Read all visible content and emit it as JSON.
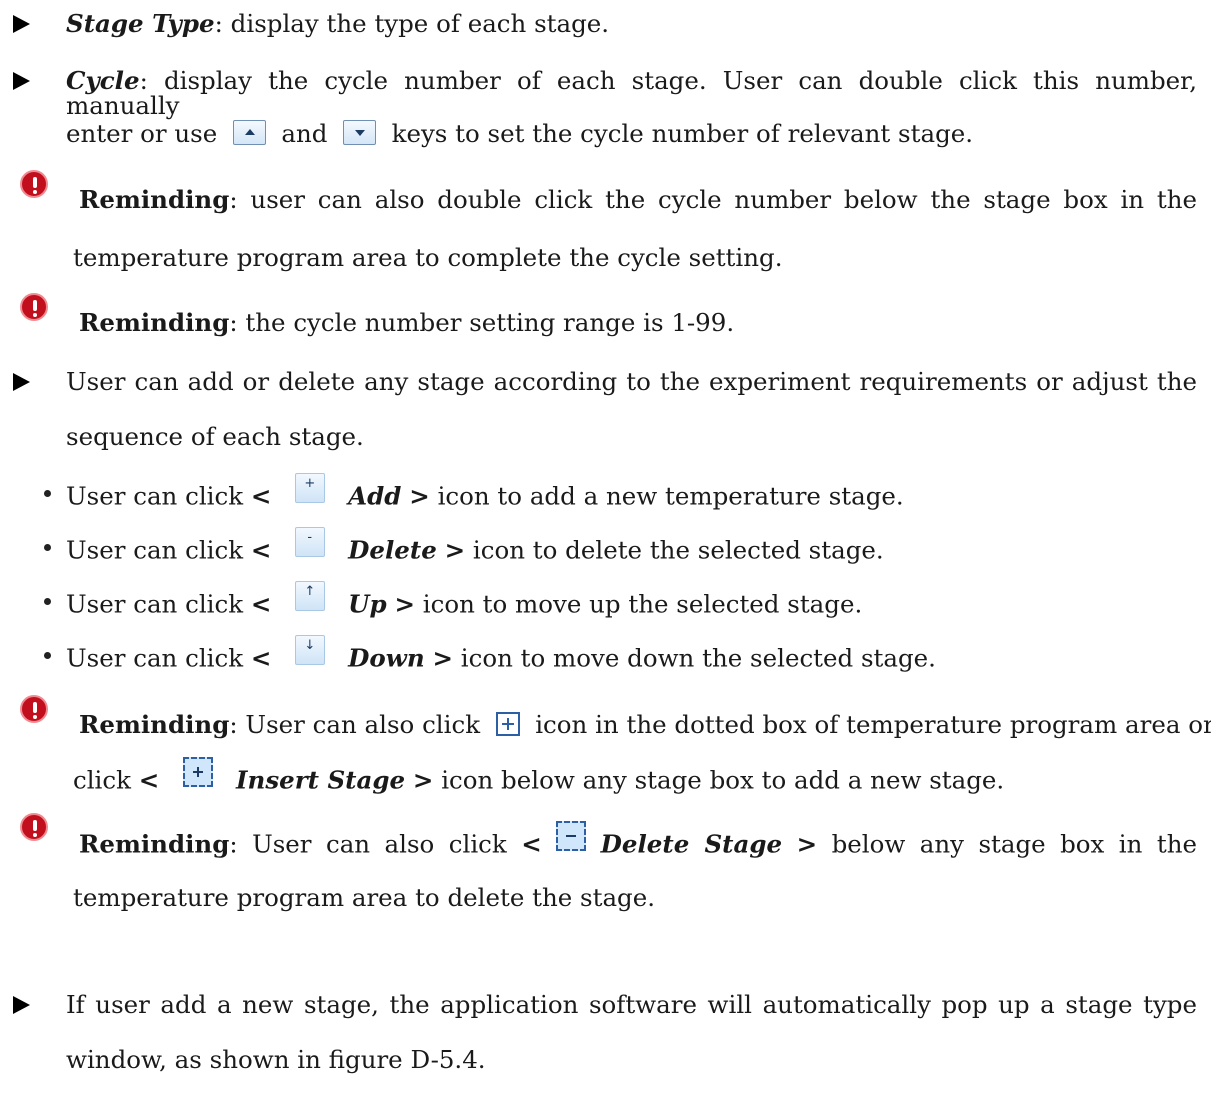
{
  "items": {
    "stage_type": {
      "term": "Stage Type",
      "text": ": display the type of each stage."
    },
    "cycle": {
      "term": "Cycle",
      "line1": ": display the cycle number of each stage. User can double click this number, manually",
      "line2_a": "enter or use",
      "line2_b": "and",
      "line2_c": "keys to set the cycle number of relevant stage."
    },
    "remind1": {
      "label": "Reminding",
      "line1": ": user can also double click the cycle number below the stage box in the",
      "line2": "temperature program area to complete the cycle setting."
    },
    "remind2": {
      "label": "Reminding",
      "text": ": the cycle number setting range is 1-99."
    },
    "addstage": {
      "line1": "User can add or delete any stage according to the experiment requirements or adjust the",
      "line2": "sequence of each stage."
    },
    "sub": {
      "prefix": "User can click",
      "lt": "<",
      "gt": ">",
      "add": {
        "icon": "+",
        "term": "Add",
        "text": "icon to add a new temperature stage."
      },
      "delete": {
        "icon": "-",
        "term": "Delete",
        "text": "icon to delete the selected stage."
      },
      "up": {
        "icon": "↑",
        "term": "Up",
        "text": "icon to move up the selected stage."
      },
      "down": {
        "icon": "↓",
        "term": "Down",
        "text": "icon to move down the selected stage."
      }
    },
    "remind3": {
      "label": "Reminding",
      "line1_a": ": User can also click",
      "line1_b": "icon in the dotted box of temperature program area or",
      "line2_a": "click",
      "term": "Insert Stage",
      "line2_b": "icon below any stage box to add a new stage."
    },
    "remind4": {
      "label": "Reminding",
      "line1_a": ": User can also click",
      "term": "Delete Stage",
      "line1_b": "below any stage box in the",
      "line2": "temperature program area to delete the stage."
    },
    "popup": {
      "line1": "If user add a new stage, the application software will automatically pop up a stage type",
      "line2": "window, as shown in figure D-5.4."
    }
  },
  "icons": {
    "bullet": "black-right-triangle",
    "reminding": "red-exclamation-circle-icon",
    "spin_up": "spin-up-icon",
    "spin_down": "spin-down-icon"
  },
  "colors": {
    "warning_red": "#c20f1e",
    "icon_blue": "#2d5fa4",
    "icon_fill": "#cfe6fb"
  }
}
